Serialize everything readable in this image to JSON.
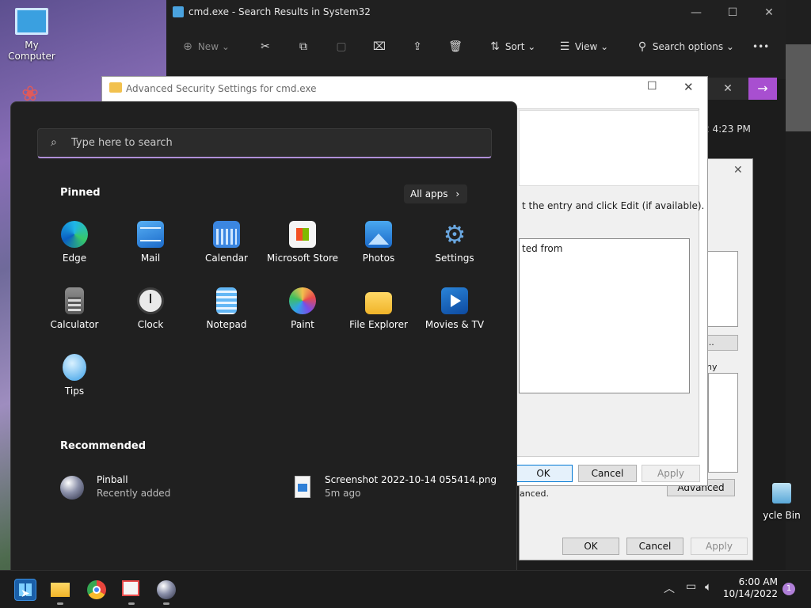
{
  "desktop": {
    "my_computer": "My Computer",
    "recycle_bin": "ycle Bin"
  },
  "explorer": {
    "title": "cmd.exe - Search Results in System32",
    "toolbar": {
      "new": "New",
      "sort": "Sort",
      "view": "View",
      "search_options": "Search options",
      "more": "•••"
    },
    "date_fragment": "2 4:23 PM"
  },
  "adv_security": {
    "title": "Advanced Security Settings for cmd.exe",
    "hint": "t the entry and click Edit (if available).",
    "column": "ted from",
    "ok": "OK",
    "cancel": "Cancel",
    "apply": "Apply"
  },
  "properties": {
    "edit_fragment": "t...",
    "any_fragment": "ny",
    "advanced": "Advanced",
    "adv_text": "anced.",
    "ok": "OK",
    "cancel": "Cancel",
    "apply": "Apply"
  },
  "start_menu": {
    "search_placeholder": "Type here to search",
    "pinned_title": "Pinned",
    "all_apps": "All apps",
    "pinned": [
      {
        "label": "Edge",
        "icon": "edge-icon"
      },
      {
        "label": "Mail",
        "icon": "mail-icon"
      },
      {
        "label": "Calendar",
        "icon": "calendar-icon"
      },
      {
        "label": "Microsoft Store",
        "icon": "store-icon"
      },
      {
        "label": "Photos",
        "icon": "photos-icon"
      },
      {
        "label": "Settings",
        "icon": "settings-icon"
      },
      {
        "label": "Calculator",
        "icon": "calculator-icon"
      },
      {
        "label": "Clock",
        "icon": "clock-icon"
      },
      {
        "label": "Notepad",
        "icon": "notepad-icon"
      },
      {
        "label": "Paint",
        "icon": "paint-icon"
      },
      {
        "label": "File Explorer",
        "icon": "folder-icon"
      },
      {
        "label": "Movies & TV",
        "icon": "movies-icon"
      },
      {
        "label": "Tips",
        "icon": "tips-icon"
      }
    ],
    "recommended_title": "Recommended",
    "recommended": [
      {
        "name": "Pinball",
        "sub": "Recently added"
      },
      {
        "name": "Screenshot 2022-10-14 055414.png",
        "sub": "5m ago"
      }
    ]
  },
  "taskbar": {
    "time": "6:00 AM",
    "date": "10/14/2022",
    "notifications": "1"
  }
}
